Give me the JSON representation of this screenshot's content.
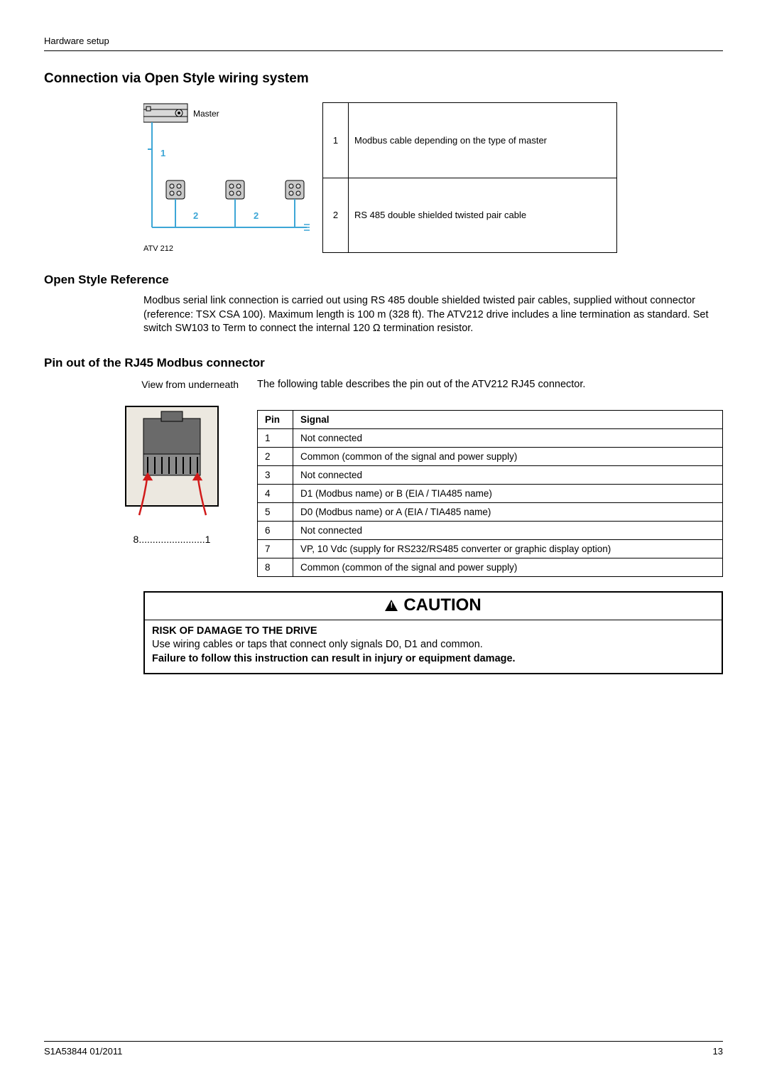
{
  "header": {
    "section": "Hardware setup"
  },
  "h_connection": "Connection via Open Style wiring system",
  "diagram": {
    "master_label": "Master",
    "wire1_label": "1",
    "wire2a_label": "2",
    "wire2b_label": "2",
    "atv_label": "ATV 212"
  },
  "legend": [
    {
      "n": "1",
      "text": "Modbus cable depending on the type of master"
    },
    {
      "n": "2",
      "text": "RS 485 double shielded twisted pair cable"
    }
  ],
  "h_openstyle": "Open Style Reference",
  "openstyle_para": "Modbus serial link connection is carried out using RS 485 double shielded twisted pair cables, supplied without connector (reference: TSX CSA 100). Maximum length is 100 m (328 ft). The ATV212 drive includes a line termination as standard. Set switch SW103 to Term to connect the internal 120 Ω termination resistor.",
  "h_pinout": "Pin out of the RJ45 Modbus connector",
  "rj45_caption": "View from underneath",
  "pin_intro": "The following table describes the pin out of the ATV212 RJ45 connector.",
  "rj45_pins_text": "8........................1",
  "pin_head": {
    "pin": "Pin",
    "signal": "Signal"
  },
  "pins": [
    {
      "n": "1",
      "s": "Not connected"
    },
    {
      "n": "2",
      "s": "Common (common of the signal and power supply)"
    },
    {
      "n": "3",
      "s": "Not connected"
    },
    {
      "n": "4",
      "s": "D1 (Modbus name) or B (EIA / TIA485 name)"
    },
    {
      "n": "5",
      "s": "D0 (Modbus name) or A (EIA / TIA485 name)"
    },
    {
      "n": "6",
      "s": "Not connected"
    },
    {
      "n": "7",
      "s": "VP, 10 Vdc (supply for RS232/RS485 converter or graphic display option)"
    },
    {
      "n": "8",
      "s": "Common (common of the signal and power supply)"
    }
  ],
  "caution": {
    "title": "CAUTION",
    "risk": "RISK OF DAMAGE TO THE DRIVE",
    "body": "Use wiring cables or taps that connect only signals D0, D1 and common.",
    "fail": "Failure to follow this instruction can result in injury or equipment damage."
  },
  "footer": {
    "doc": "S1A53844 01/2011",
    "page": "13"
  }
}
